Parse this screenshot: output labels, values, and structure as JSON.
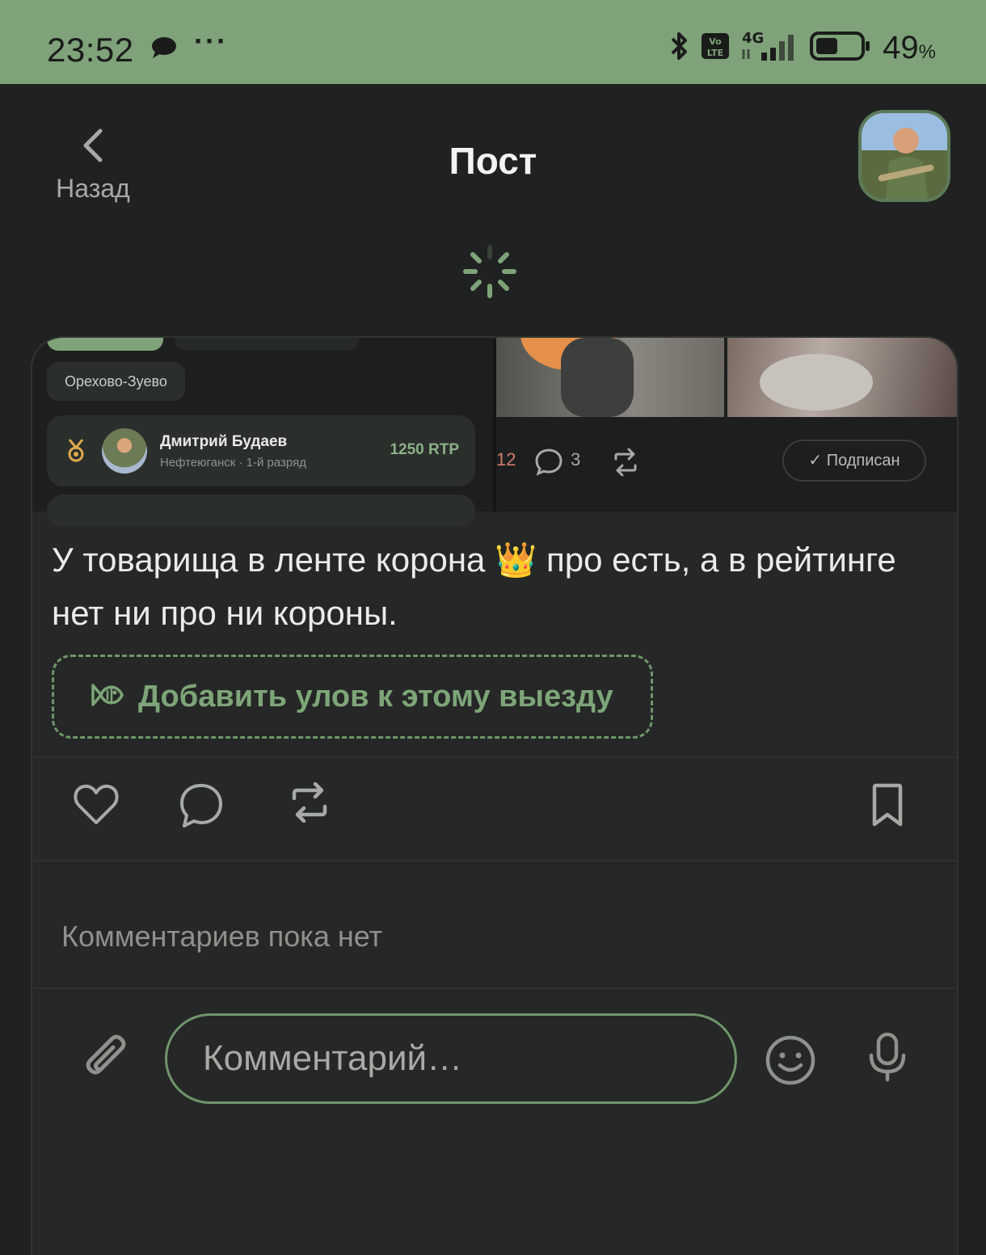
{
  "status_bar": {
    "time": "23:52",
    "network": "4G",
    "volte": "Vo LTE",
    "battery_percent": "49",
    "battery_unit": "%"
  },
  "header": {
    "back_label": "Назад",
    "title": "Пост"
  },
  "embedded_screenshot": {
    "city_chip": "Орехово-Зуево",
    "rank_user_name": "Дмитрий Будаев",
    "rank_user_sub": "Нефтеюганск · 1-й разряд",
    "rank_points": "1250 RTP",
    "likes_count": "12",
    "comments_count": "3",
    "subscribed_label": "✓ Подписан"
  },
  "post": {
    "text": "У товарища в ленте корона 👑 про есть, а в рейтинге нет ни про ни короны.",
    "add_catch_label": "Добавить улов к этому выезду"
  },
  "comments": {
    "empty_text": "Комментариев пока нет",
    "input_placeholder": "Комментарий…"
  },
  "colors": {
    "accent": "#7fa27a",
    "background": "#1f2221",
    "card": "#252826"
  }
}
